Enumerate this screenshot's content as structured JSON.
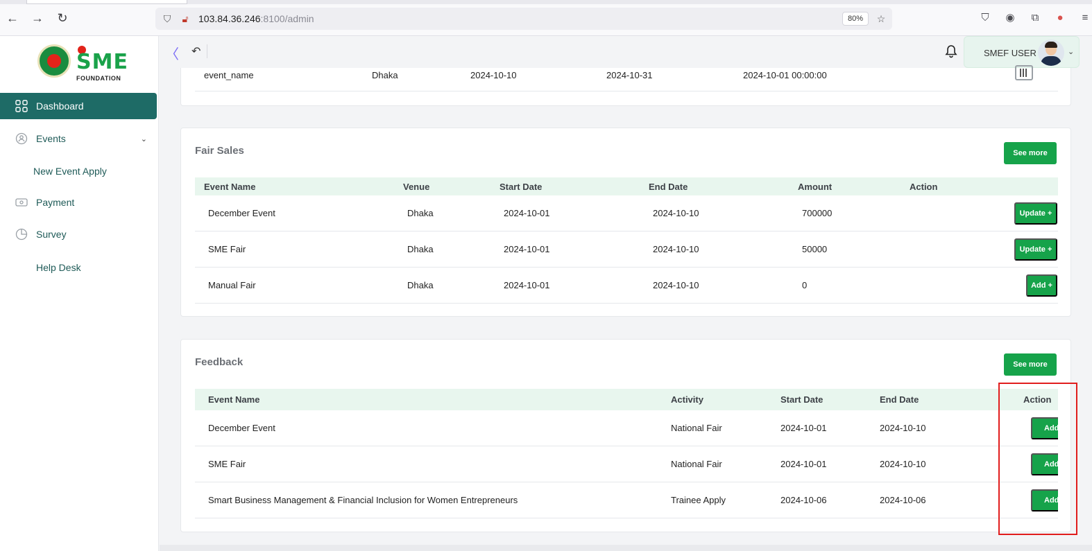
{
  "browser": {
    "url_host": "103.84.36.246",
    "url_path": ":8100/admin",
    "zoom": "80%"
  },
  "sidebar": {
    "logo_text": "SME",
    "logo_subtext": "FOUNDATION",
    "items": [
      {
        "label": "Dashboard",
        "icon": "grid-icon"
      },
      {
        "label": "Events",
        "icon": "events-icon"
      },
      {
        "label": "New Event Apply"
      },
      {
        "label": "Payment",
        "icon": "payment-icon"
      },
      {
        "label": "Survey",
        "icon": "pie-chart-icon"
      },
      {
        "label": "Help Desk"
      }
    ]
  },
  "header": {
    "user_name": "SMEF USER"
  },
  "events_partial": {
    "row": [
      "event_name",
      "Dhaka",
      "2024-10-10",
      "2024-10-31",
      "2024-10-01 00:00:00"
    ]
  },
  "fair_sales": {
    "title": "Fair Sales",
    "see_more": "See more",
    "columns": [
      "Event Name",
      "Venue",
      "Start Date",
      "End Date",
      "Amount",
      "Action"
    ],
    "rows": [
      {
        "event": "December Event",
        "venue": "Dhaka",
        "start": "2024-10-01",
        "end": "2024-10-10",
        "amount": "700000",
        "action": "Update +"
      },
      {
        "event": "SME Fair",
        "venue": "Dhaka",
        "start": "2024-10-01",
        "end": "2024-10-10",
        "amount": "50000",
        "action": "Update +"
      },
      {
        "event": "Manual Fair",
        "venue": "Dhaka",
        "start": "2024-10-01",
        "end": "2024-10-10",
        "amount": "0",
        "action": "Add +"
      }
    ]
  },
  "feedback": {
    "title": "Feedback",
    "see_more": "See more",
    "columns": [
      "Event Name",
      "Activity",
      "Start Date",
      "End Date",
      "Action"
    ],
    "rows": [
      {
        "event": "December Event",
        "activity": "National Fair",
        "start": "2024-10-01",
        "end": "2024-10-10",
        "action": "Add"
      },
      {
        "event": "SME Fair",
        "activity": "National Fair",
        "start": "2024-10-01",
        "end": "2024-10-10",
        "action": "Add"
      },
      {
        "event": "Smart Business Management & Financial Inclusion for Women Entrepreneurs",
        "activity": "Trainee Apply",
        "start": "2024-10-06",
        "end": "2024-10-06",
        "action": "Add"
      }
    ]
  },
  "colors": {
    "primary": "#16a34a",
    "sidebar_active": "#1e6b66",
    "table_header_bg": "#e8f6ee",
    "highlight": "#e11d1d"
  }
}
